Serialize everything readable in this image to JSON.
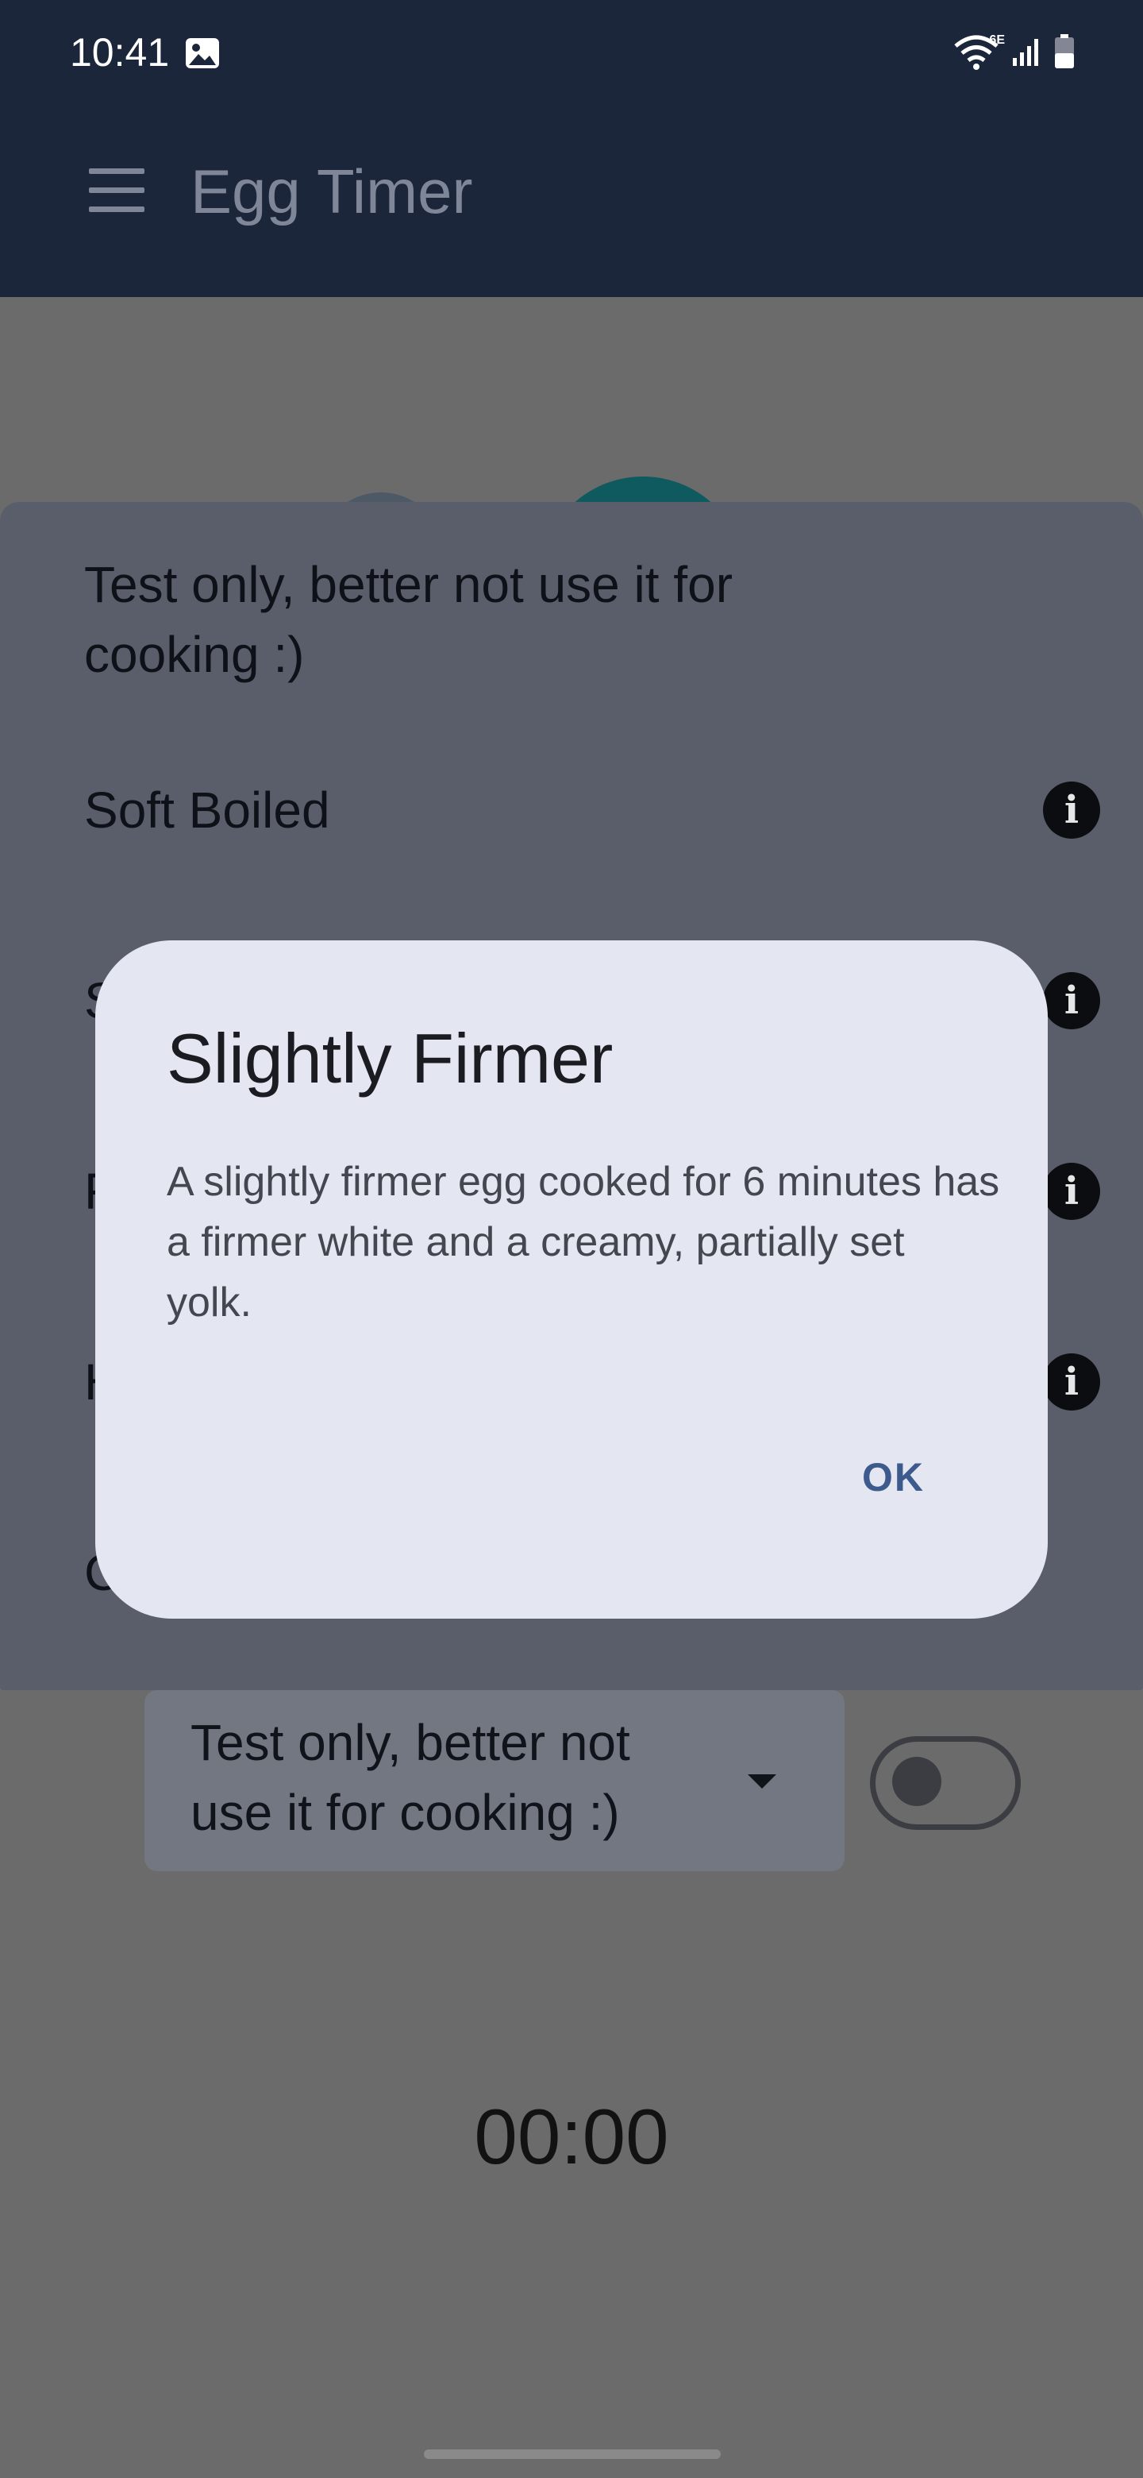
{
  "status_bar": {
    "time": "10:41",
    "network": "6E"
  },
  "app_bar": {
    "title": "Egg Timer"
  },
  "menu_sheet": {
    "items": [
      "Test only, better not use it for cooking :)",
      "Soft Boiled",
      "S",
      "F",
      "H",
      "C"
    ]
  },
  "dialog": {
    "title": "Slightly Firmer",
    "body": "A slightly firmer egg cooked for 6 minutes has a firmer white and a creamy, partially set yolk.",
    "ok_label": "OK"
  },
  "controls": {
    "dropdown_value": "Test only, better not use it for cooking :)",
    "toggle_on": false
  },
  "timer": {
    "display": "00:00"
  },
  "colors": {
    "app_bar": "#1c263b",
    "dialog_bg": "#e4e6f1",
    "accent": "#3c5a8c"
  }
}
